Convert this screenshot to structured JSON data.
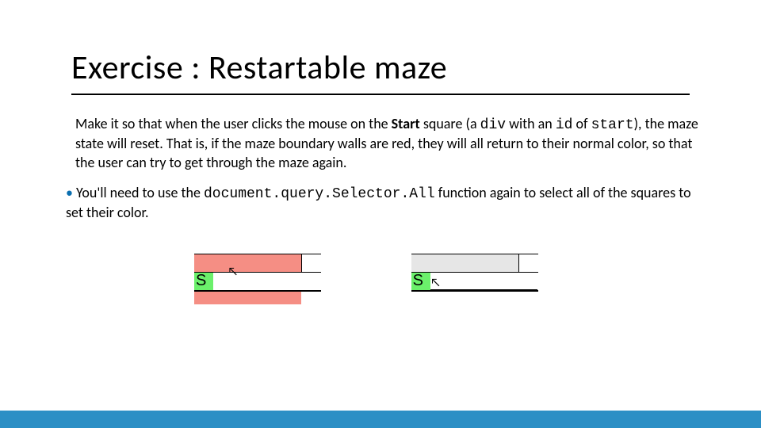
{
  "title": "Exercise : Restartable maze",
  "para1": {
    "t1": "Make it so that when the user clicks the mouse on the ",
    "start": "Start",
    "t2": " square (a ",
    "c1": "div",
    "t3": " with an ",
    "c2": "id",
    "t4": " of ",
    "c3": "start",
    "t5": "), the maze state will reset. That is, if the maze boundary walls are red, they will all return to their normal color, so that the user can try to get through the maze again."
  },
  "bullet1": {
    "t1": "You'll need to use the ",
    "c1": "document.query.Selector.All",
    "t2": " function again to select all of the squares to set their color."
  },
  "maze": {
    "s_label": "S"
  }
}
